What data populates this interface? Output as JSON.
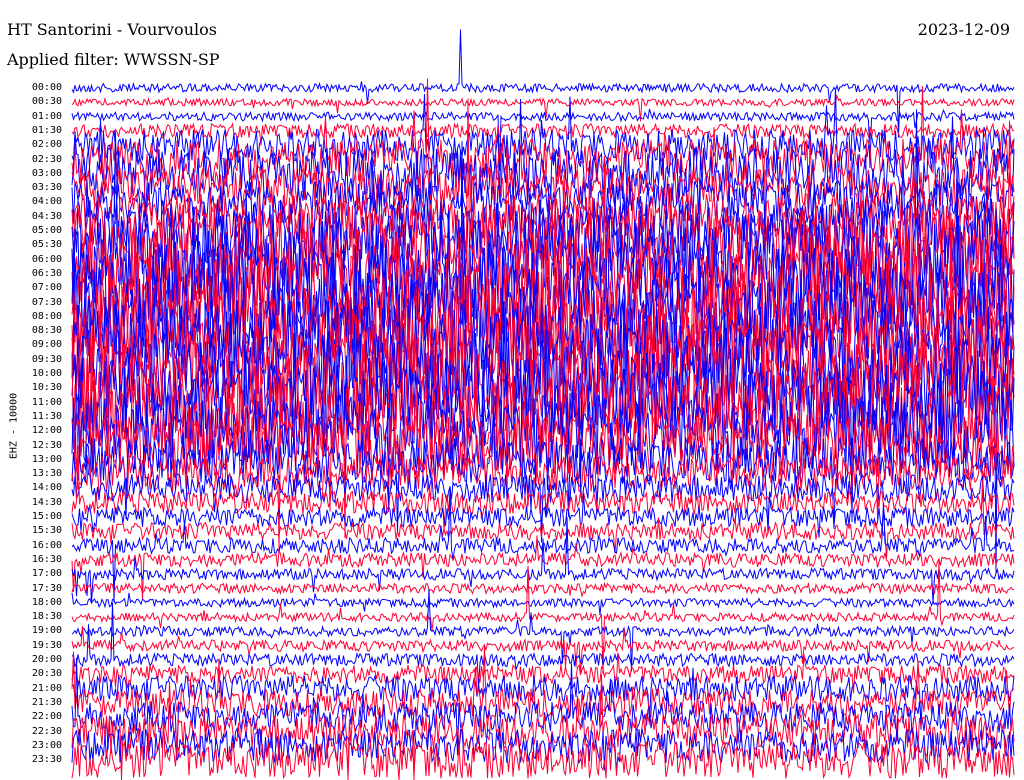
{
  "header": {
    "station": "HT Santorini - Vourvoulos",
    "filter": "Applied filter: WWSSN-SP",
    "date": "2023-12-09"
  },
  "colors": {
    "trace_a": "#0000ff",
    "trace_b": "#ff0033",
    "background": "#ffffff"
  },
  "chart_data": {
    "type": "line",
    "title": "HT Santorini - Vourvoulos",
    "subtitle": "Applied filter: WWSSN-SP",
    "ylabel": "EHZ - 10000",
    "row_labels": [
      "00:00",
      "00:30",
      "01:00",
      "01:30",
      "02:00",
      "02:30",
      "03:00",
      "03:30",
      "04:00",
      "04:30",
      "05:00",
      "05:30",
      "06:00",
      "06:30",
      "07:00",
      "07:30",
      "08:00",
      "08:30",
      "09:00",
      "09:30",
      "10:00",
      "10:30",
      "11:00",
      "11:30",
      "12:00",
      "12:30",
      "13:00",
      "13:30",
      "14:00",
      "14:30",
      "15:00",
      "15:30",
      "16:00",
      "16:30",
      "17:00",
      "17:30",
      "18:00",
      "18:30",
      "19:00",
      "19:30",
      "20:00",
      "20:30",
      "21:00",
      "21:30",
      "22:00",
      "22:30",
      "23:00",
      "23:30"
    ],
    "series": [
      {
        "color": "#0000ff"
      },
      {
        "color": "#ff0033"
      }
    ],
    "row_amplitude": [
      0.6,
      0.5,
      0.6,
      1.0,
      2.2,
      3.0,
      3.6,
      2.8,
      3.0,
      3.2,
      4.5,
      6.0,
      6.5,
      6.5,
      6.5,
      6.5,
      6.5,
      6.5,
      6.5,
      6.5,
      6.5,
      6.5,
      6.3,
      6.0,
      5.5,
      4.5,
      3.2,
      2.6,
      2.0,
      1.6,
      1.4,
      1.2,
      1.1,
      1.0,
      0.8,
      0.7,
      0.6,
      0.6,
      0.7,
      0.8,
      0.9,
      1.3,
      1.8,
      2.0,
      2.2,
      2.4,
      2.4,
      2.6
    ],
    "grid": false,
    "legend": "none"
  }
}
